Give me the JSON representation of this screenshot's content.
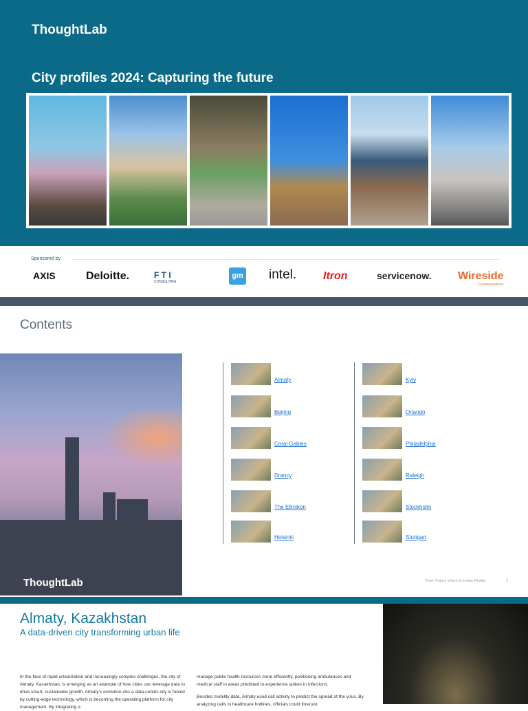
{
  "cover": {
    "brand": "ThoughtLab",
    "title": "City profiles 2024: Capturing the future"
  },
  "sponsors": {
    "label": "Sponsored by",
    "logos": [
      "AXIS",
      "Deloitte.",
      "F T I",
      "gm",
      "intel.",
      "Itron",
      "servicenow.",
      "Wireside"
    ],
    "fti_sub": "CONSULTING",
    "wireside_sub": "Communications"
  },
  "contents": {
    "heading": "Contents",
    "image_brand": "ThoughtLab",
    "left": [
      "Almaty",
      "Beijing",
      "Coral Gables",
      "Drancy",
      "The Ellinikon",
      "Helsinki"
    ],
    "right": [
      "Kyiv",
      "Orlando",
      "Philadelphia",
      "Raleigh",
      "Stockholm",
      "Stuttgart"
    ],
    "footer": "From Future Vision to Urban Reality",
    "page": "2"
  },
  "profile": {
    "title": "Almaty, Kazakhstan",
    "subtitle": "A data-driven city transforming urban life",
    "col1": "In the face of rapid urbanization and increasingly complex challenges, the city of Almaty, Kazakhstan, is emerging as an example of how cities can leverage data to drive smart, sustainable growth. Almaty's evolution into a data-centric city is fueled by cutting-edge technology, which is becoming the operating platform for city management. By integrating a",
    "col2a": "manage public health resources more efficiently, positioning ambulances and medical staff in areas predicted to experience spikes in infections.",
    "col2b": "Besides mobility data, Almaty used call activity to predict the spread of the virus. By analyzing calls to healthcare hotlines, officials could forecast"
  }
}
